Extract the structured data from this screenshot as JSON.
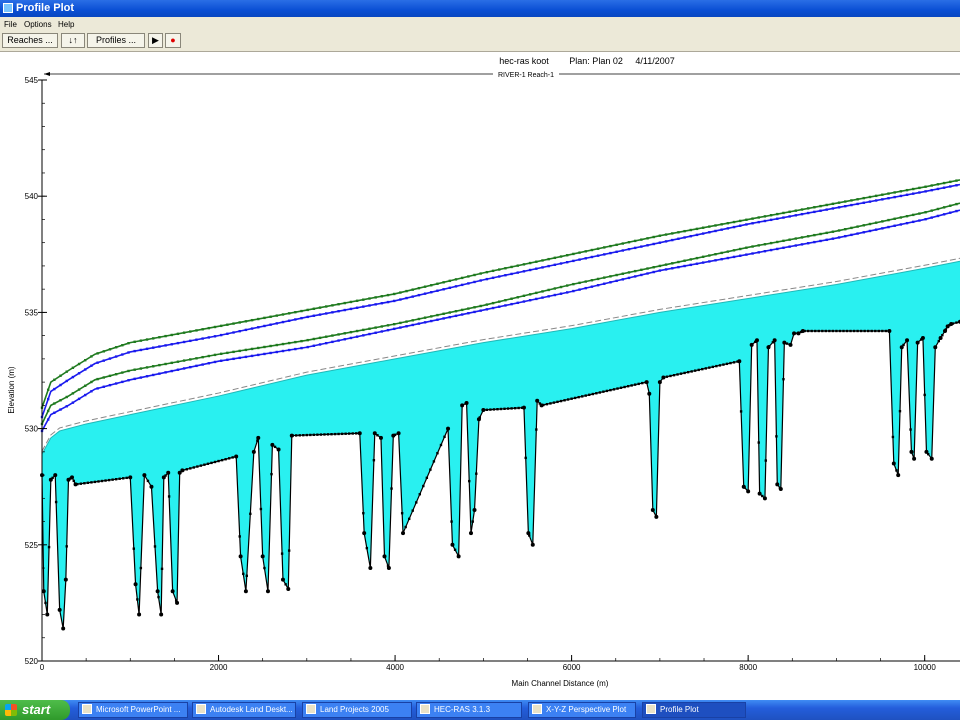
{
  "window": {
    "title": "Profile Plot"
  },
  "menu": [
    "File",
    "Options",
    "Help"
  ],
  "toolbar": {
    "reaches_label": "Reaches ...",
    "profiles_label": "Profiles ..."
  },
  "plot": {
    "header": {
      "project": "hec-ras koot",
      "plan": "Plan: Plan 02",
      "date": "4/11/2007"
    },
    "reach_label": "RIVER-1 Reach-1"
  },
  "chart_data": {
    "type": "line",
    "title": "hec-ras koot    Plan: Plan 02    4/11/2007",
    "xlabel": "Main Channel Distance (m)",
    "ylabel": "Elevation (m)",
    "xlim": [
      0,
      10400
    ],
    "ylim": [
      520,
      545
    ],
    "xticks": [
      0,
      2000,
      4000,
      6000,
      8000,
      10000
    ],
    "yticks": [
      520,
      525,
      530,
      535,
      540,
      545
    ],
    "grid": false,
    "colors": {
      "water_fill": "#29f0f0",
      "ground": "#000000",
      "energy_grade": "#1f7a1f",
      "water_surface": "#1a1aee",
      "critical": "#888888"
    },
    "series": [
      {
        "role": "energy-grade-upper",
        "x": [
          0,
          100,
          300,
          600,
          1000,
          2000,
          3000,
          4000,
          5000,
          6000,
          7000,
          8000,
          9000,
          10000,
          10400
        ],
        "y": [
          530.9,
          532.0,
          532.5,
          533.2,
          533.7,
          534.4,
          535.1,
          535.8,
          536.7,
          537.5,
          538.3,
          539.0,
          539.7,
          540.4,
          540.7
        ]
      },
      {
        "role": "water-surface-upper",
        "x": [
          0,
          100,
          300,
          600,
          1000,
          2000,
          3000,
          4000,
          5000,
          6000,
          7000,
          8000,
          9000,
          10000,
          10400
        ],
        "y": [
          530.5,
          531.6,
          532.1,
          532.8,
          533.3,
          534.0,
          534.8,
          535.5,
          536.4,
          537.2,
          538.0,
          538.8,
          539.5,
          540.2,
          540.5
        ]
      },
      {
        "role": "energy-grade-lower",
        "x": [
          0,
          100,
          300,
          600,
          1000,
          2000,
          3000,
          4000,
          5000,
          6000,
          7000,
          8000,
          9000,
          10000,
          10400
        ],
        "y": [
          530.2,
          531.0,
          531.4,
          532.1,
          532.5,
          533.2,
          533.8,
          534.5,
          535.3,
          536.2,
          537.0,
          537.8,
          538.5,
          539.3,
          539.7
        ]
      },
      {
        "role": "water-surface-lower",
        "x": [
          0,
          100,
          300,
          600,
          1000,
          2000,
          3000,
          4000,
          5000,
          6000,
          7000,
          8000,
          9000,
          10000,
          10400
        ],
        "y": [
          529.9,
          530.6,
          531.0,
          531.7,
          532.1,
          532.9,
          533.5,
          534.3,
          535.1,
          535.9,
          536.8,
          537.5,
          538.2,
          539.0,
          539.4
        ]
      },
      {
        "role": "water-surface-fill",
        "x": [
          0,
          100,
          200,
          300,
          500,
          1000,
          2000,
          3000,
          4000,
          5000,
          6000,
          7000,
          8000,
          9000,
          10000,
          10400
        ],
        "y": [
          528.9,
          529.6,
          529.9,
          530.0,
          530.2,
          530.6,
          531.4,
          532.3,
          533.0,
          533.7,
          534.3,
          535.0,
          535.6,
          536.2,
          536.9,
          537.2
        ]
      },
      {
        "role": "ground",
        "x": [
          0,
          20,
          60,
          100,
          150,
          200,
          240,
          270,
          300,
          340,
          380,
          1000,
          1060,
          1100,
          1160,
          1240,
          1310,
          1350,
          1380,
          1430,
          1480,
          1530,
          1560,
          1590,
          2200,
          2250,
          2310,
          2400,
          2450,
          2500,
          2560,
          2610,
          2680,
          2730,
          2790,
          2830,
          3600,
          3650,
          3720,
          3770,
          3840,
          3880,
          3930,
          3980,
          4040,
          4090,
          4600,
          4650,
          4720,
          4760,
          4810,
          4860,
          4900,
          4950,
          5000,
          5460,
          5510,
          5560,
          5610,
          5660,
          6850,
          6880,
          6920,
          6960,
          7000,
          7040,
          7900,
          7950,
          8000,
          8040,
          8100,
          8130,
          8190,
          8230,
          8300,
          8330,
          8370,
          8410,
          8480,
          8520,
          8570,
          8620,
          9600,
          9650,
          9700,
          9740,
          9800,
          9850,
          9880,
          9920,
          9980,
          10020,
          10080,
          10120,
          10180,
          10230,
          10260,
          10300,
          10400
        ],
        "y": [
          528.0,
          523.0,
          522.0,
          527.8,
          528.0,
          522.2,
          521.4,
          523.5,
          527.8,
          527.9,
          527.6,
          527.9,
          523.3,
          522.0,
          528.0,
          527.5,
          523.0,
          522.0,
          527.9,
          528.1,
          523.0,
          522.5,
          528.1,
          528.2,
          528.8,
          524.5,
          523.0,
          529.0,
          529.6,
          524.5,
          523.0,
          529.3,
          529.1,
          523.5,
          523.1,
          529.7,
          529.8,
          525.5,
          524.0,
          529.8,
          529.6,
          524.5,
          524.0,
          529.7,
          529.8,
          525.5,
          530.0,
          525.0,
          524.5,
          531.0,
          531.1,
          525.5,
          526.5,
          530.4,
          530.8,
          530.9,
          525.5,
          525.0,
          531.2,
          531.0,
          532.0,
          531.5,
          526.5,
          526.2,
          532.0,
          532.2,
          532.9,
          527.5,
          527.3,
          533.6,
          533.8,
          527.2,
          527.0,
          533.5,
          533.8,
          527.6,
          527.4,
          533.7,
          533.6,
          534.1,
          534.1,
          534.2,
          534.2,
          528.5,
          528.0,
          533.5,
          533.8,
          529.0,
          528.7,
          533.7,
          533.9,
          529.0,
          528.7,
          533.5,
          533.9,
          534.2,
          534.4,
          534.5,
          534.6
        ]
      }
    ]
  },
  "taskbar": {
    "start_label": "start",
    "tasks": [
      "Microsoft PowerPoint ...",
      "Autodesk Land Deskt...",
      "Land Projects 2005",
      "HEC-RAS 3.1.3",
      "X-Y-Z Perspective Plot",
      "Profile Plot"
    ]
  }
}
